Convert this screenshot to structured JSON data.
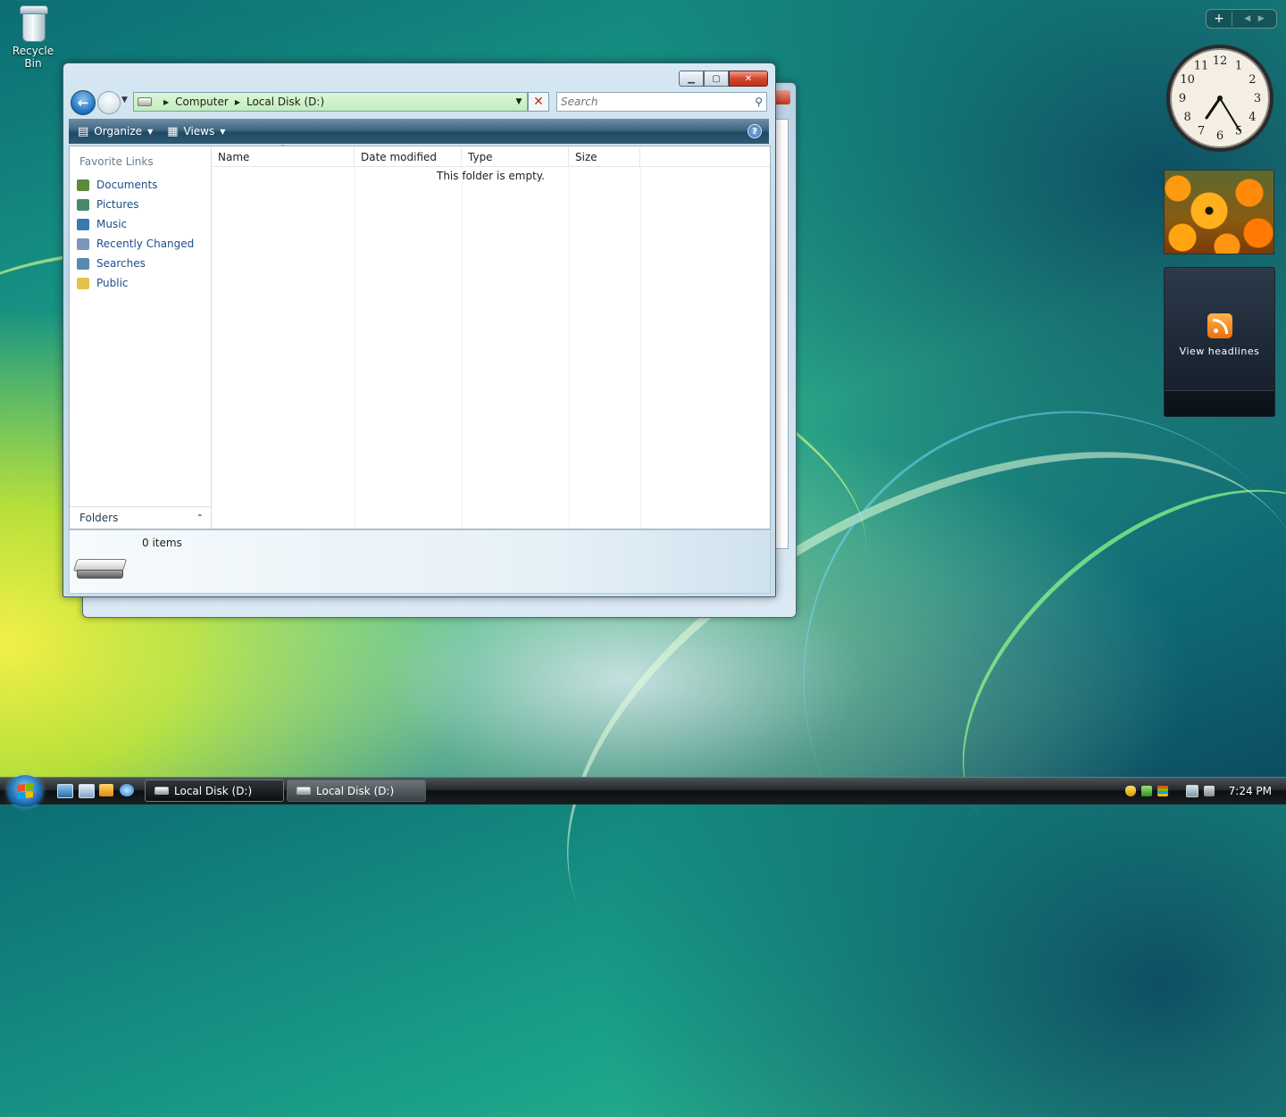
{
  "desktop": {
    "icons": [
      {
        "label": "Recycle Bin",
        "icon": "recycle-bin-icon"
      }
    ]
  },
  "window": {
    "caption_buttons": {
      "minimize": "minimize",
      "maximize": "maximize",
      "close": "close"
    },
    "address": {
      "segments": [
        "Computer",
        "Local Disk (D:)"
      ]
    },
    "search": {
      "placeholder": "Search"
    },
    "toolbar": {
      "organize": "Organize",
      "views": "Views",
      "help": "?"
    },
    "favorite_links": {
      "header": "Favorite Links",
      "items": [
        {
          "label": "Documents",
          "icon": "documents-icon",
          "color": "#5b8a3c"
        },
        {
          "label": "Pictures",
          "icon": "pictures-icon",
          "color": "#4a8a6a"
        },
        {
          "label": "Music",
          "icon": "music-icon",
          "color": "#3a7ab0"
        },
        {
          "label": "Recently Changed",
          "icon": "recently-changed-icon",
          "color": "#7a96b8"
        },
        {
          "label": "Searches",
          "icon": "searches-icon",
          "color": "#5a88b0"
        },
        {
          "label": "Public",
          "icon": "public-folder-icon",
          "color": "#e6c04a"
        }
      ]
    },
    "folders_label": "Folders",
    "columns": [
      "Name",
      "Date modified",
      "Type",
      "Size"
    ],
    "empty_message": "This folder is empty.",
    "details": {
      "item_count": "0 items"
    }
  },
  "gadgets": {
    "feeds_text": "View headlines",
    "clock": {
      "numbers": [
        "12",
        "1",
        "2",
        "3",
        "4",
        "5",
        "6",
        "7",
        "8",
        "9",
        "10",
        "11"
      ],
      "time": "7:24"
    }
  },
  "taskbar": {
    "tasks": [
      {
        "label": "Local Disk (D:)",
        "active": true
      },
      {
        "label": "Local Disk (D:)",
        "active": false
      }
    ],
    "clock": "7:24 PM"
  },
  "colors": {
    "accent": "#1c4e8a",
    "toolbar": "#2e5a74",
    "address_bg": "#c2eebd",
    "close_button": "#c0301c"
  }
}
